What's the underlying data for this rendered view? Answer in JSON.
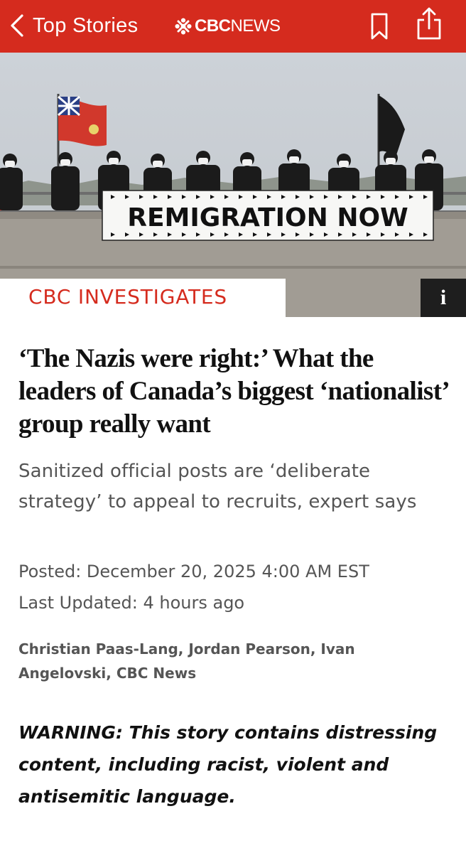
{
  "nav": {
    "back_label": "Top Stories",
    "brand_cbc": "CBC",
    "brand_news": "NEWS",
    "accent_color": "#d52b1e",
    "icons": [
      "chevron-left-icon",
      "cbc-gem-logo",
      "bookmark-icon",
      "share-icon"
    ]
  },
  "hero": {
    "banner_text": "REMIGRATION NOW"
  },
  "article": {
    "category": "CBC INVESTIGATES",
    "info_label": "i",
    "headline": "‘The Nazis were right:’ What the leaders of Canada’s biggest ‘nationalist’ group really want",
    "subheadline": "Sanitized official posts are ‘deliberate strategy’ to appeal to recruits, expert says",
    "posted": "Posted: December 20, 2025 4:00 AM EST",
    "last_updated": "Last Updated: 4 hours ago",
    "byline": "Christian Paas-Lang, Jordan Pearson, Ivan Angelovski, CBC News",
    "warning_label": "WARNING:",
    "warning_text": " This story contains distressing content, including racist, violent and antisemitic language."
  }
}
